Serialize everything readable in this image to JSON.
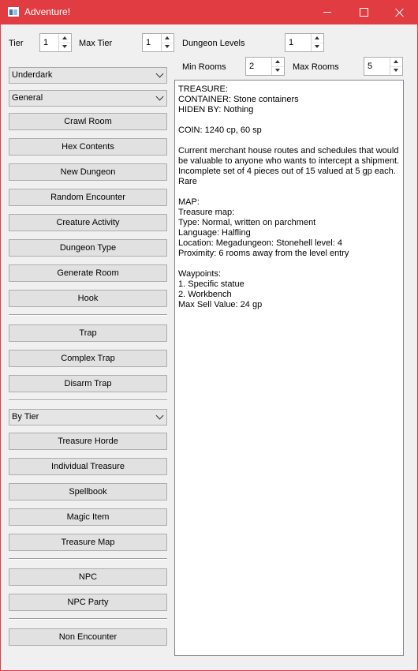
{
  "window": {
    "title": "Adventure!"
  },
  "controls": {
    "tier_label": "Tier",
    "tier_value": "1",
    "max_tier_label": "Max Tier",
    "max_tier_value": "1",
    "dungeon_levels_label": "Dungeon Levels",
    "dungeon_levels_value": "1",
    "min_rooms_label": "Min Rooms",
    "min_rooms_value": "2",
    "max_rooms_label": "Max Rooms",
    "max_rooms_value": "5"
  },
  "sidebar": {
    "region_select": "Underdark",
    "type_select": "General",
    "dungeon_buttons": [
      "Crawl Room",
      "Hex Contents",
      "New Dungeon",
      "Random Encounter",
      "Creature Activity",
      "Dungeon Type",
      "Generate Room",
      "Hook"
    ],
    "trap_buttons": [
      "Trap",
      "Complex Trap",
      "Disarm Trap"
    ],
    "treasure_select": "By Tier",
    "treasure_buttons": [
      "Treasure Horde",
      "Individual Treasure",
      "Spellbook",
      "Magic Item",
      "Treasure Map"
    ],
    "npc_buttons": [
      "NPC",
      "NPC Party"
    ],
    "other_buttons": [
      "Non Encounter"
    ]
  },
  "output": {
    "lines": [
      "TREASURE:",
      "CONTAINER: Stone containers",
      "HIDEN BY: Nothing",
      "",
      "COIN: 1240 cp, 60 sp",
      "",
      "Current merchant house routes and schedules that would",
      "be valuable to anyone who wants to intercept a shipment.",
      "Incomplete set of 4 pieces out of 15 valued at 5 gp each.",
      "Rare",
      "",
      "MAP:",
      "Treasure map:",
      "Type: Normal, written on parchment",
      "Language: Halfling",
      "Location: Megadungeon: Stonehell level: 4",
      "Proximity: 6 rooms away from the level entry",
      "",
      "Waypoints:",
      "1. Specific statue",
      "2. Workbench",
      "Max Sell Value: 24 gp"
    ]
  }
}
